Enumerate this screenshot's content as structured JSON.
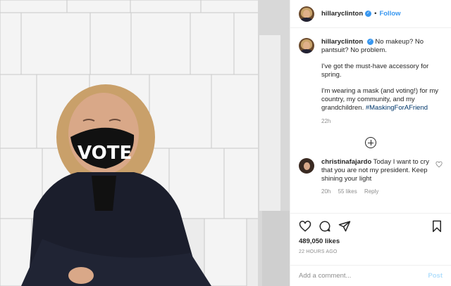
{
  "post": {
    "username": "hillaryclinton",
    "follow_label": "Follow",
    "mask_text": "VOTE"
  },
  "caption": {
    "username": "hillaryclinton",
    "line1": "No makeup? No pantsuit? No problem.",
    "line2": "I've got the must-have accessory for spring.",
    "line3": "I'm wearing a mask (and voting!) for my country, my community, and my grandchildren.",
    "hashtag": "#MaskingForAFriend",
    "time": "22h"
  },
  "comment": {
    "username": "christinafajardo",
    "text": "Today I want to cry that you are not my president. Keep shining your light",
    "time": "20h",
    "likes": "55 likes",
    "reply_label": "Reply"
  },
  "actions": {
    "likes_count": "489,050 likes",
    "posted_ago": "22 HOURS AGO"
  },
  "add_comment": {
    "placeholder": "Add a comment...",
    "post_label": "Post"
  },
  "colors": {
    "link": "#3897f0",
    "hashtag": "#00376b",
    "muted": "#8e8e8e"
  }
}
